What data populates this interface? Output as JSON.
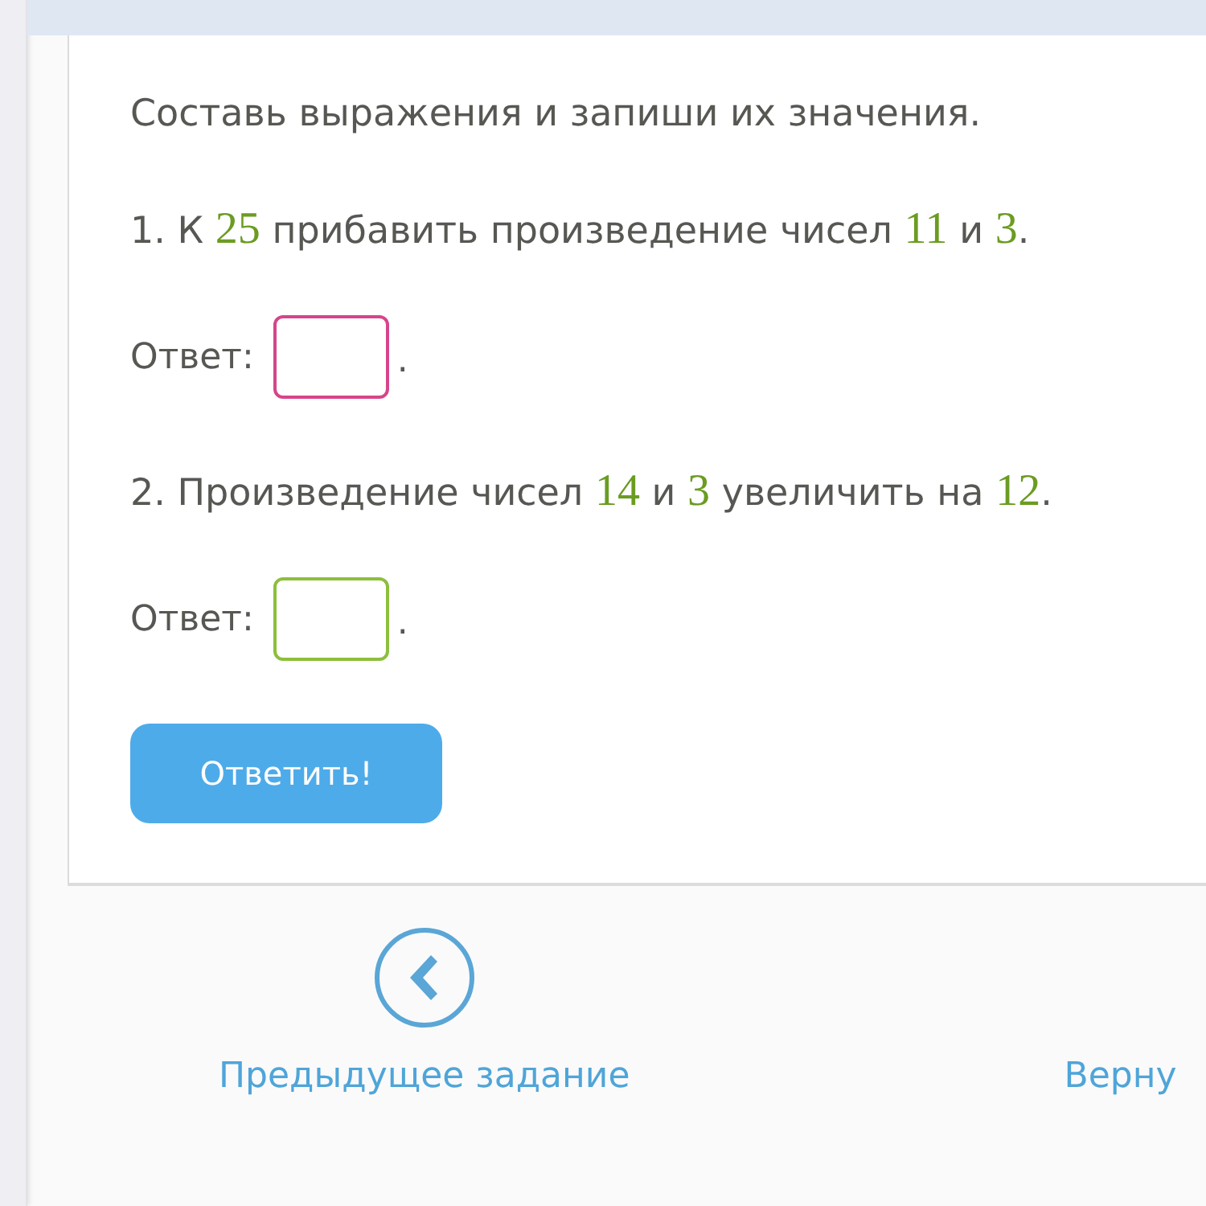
{
  "instruction": "Составь выражения и запиши их значения.",
  "tasks": [
    {
      "parts": [
        {
          "kind": "text",
          "text": "1. К "
        },
        {
          "kind": "number",
          "text": "25"
        },
        {
          "kind": "text",
          "text": " прибавить произведение чисел "
        },
        {
          "kind": "number",
          "text": "11"
        },
        {
          "kind": "text",
          "text": " и "
        },
        {
          "kind": "number",
          "text": "3"
        },
        {
          "kind": "text",
          "text": "."
        }
      ],
      "answer": {
        "label": "Ответ:",
        "color": "#d6458a",
        "suffix": "."
      }
    },
    {
      "parts": [
        {
          "kind": "text",
          "text": "2. Произведение чисел "
        },
        {
          "kind": "number",
          "text": "14"
        },
        {
          "kind": "text",
          "text": " и "
        },
        {
          "kind": "number",
          "text": "3"
        },
        {
          "kind": "text",
          "text": " увеличить на "
        },
        {
          "kind": "number",
          "text": "12"
        },
        {
          "kind": "text",
          "text": "."
        }
      ],
      "answer": {
        "label": "Ответ:",
        "color": "#8dbf3c",
        "suffix": "."
      }
    }
  ],
  "submit_button": "Ответить!",
  "nav_links": [
    {
      "kind": "icon-link",
      "label": "Предыдущее задание"
    },
    {
      "kind": "text-link",
      "label": "Верну"
    }
  ]
}
